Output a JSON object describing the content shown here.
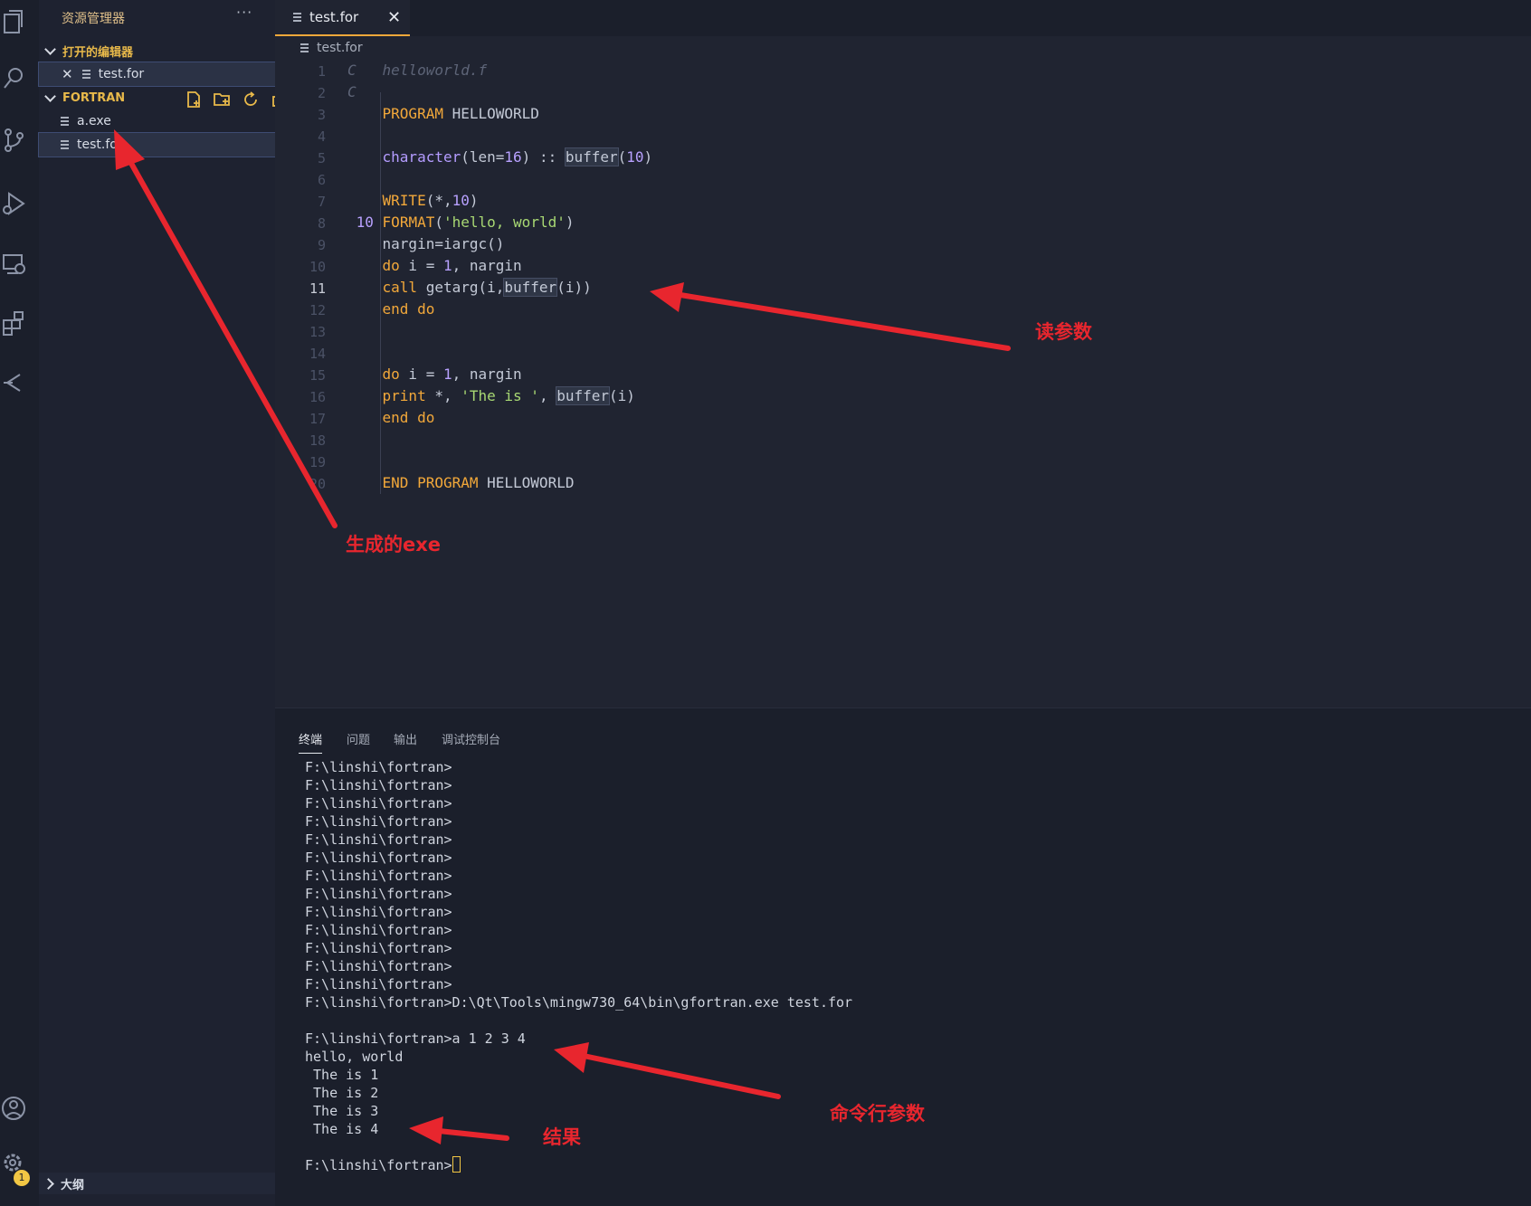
{
  "sidebar": {
    "title": "资源管理器",
    "more": "···",
    "open_editors_label": "打开的编辑器",
    "open_file": "test.for",
    "folder_label": "FORTRAN",
    "files": [
      "a.exe",
      "test.for"
    ],
    "outline_label": "大纲",
    "badge": "1"
  },
  "editor": {
    "tab_label": "test.for",
    "breadcrumb": "test.for",
    "line_numbers": [
      "1",
      "2",
      "3",
      "4",
      "5",
      "6",
      "7",
      "8",
      "9",
      "10",
      "11",
      "12",
      "13",
      "14",
      "15",
      "16",
      "17",
      "18",
      "19",
      "20"
    ],
    "current_line": "11"
  },
  "panel": {
    "tabs": [
      "终端",
      "问题",
      "输出",
      "调试控制台"
    ],
    "prompt_lines": [
      "F:\\linshi\\fortran>",
      "F:\\linshi\\fortran>",
      "F:\\linshi\\fortran>",
      "F:\\linshi\\fortran>",
      "F:\\linshi\\fortran>",
      "F:\\linshi\\fortran>",
      "F:\\linshi\\fortran>",
      "F:\\linshi\\fortran>",
      "F:\\linshi\\fortran>",
      "F:\\linshi\\fortran>",
      "F:\\linshi\\fortran>",
      "F:\\linshi\\fortran>",
      "F:\\linshi\\fortran>"
    ],
    "compile_line": "F:\\linshi\\fortran>D:\\Qt\\Tools\\mingw730_64\\bin\\gfortran.exe test.for",
    "run_line": "F:\\linshi\\fortran>a 1 2 3 4",
    "output_lines": [
      "hello, world",
      " The is 1",
      " The is 2",
      " The is 3",
      " The is 4"
    ],
    "final_prompt": "F:\\linshi\\fortran>"
  },
  "annotations": {
    "exe_label": "生成的exe",
    "read_args_label": "读参数",
    "cmd_args_label": "命令行参数",
    "result_label": "结果"
  },
  "colors": {
    "accent": "#f2a83a",
    "annotation": "#e8262e",
    "badge": "#f2c744"
  }
}
